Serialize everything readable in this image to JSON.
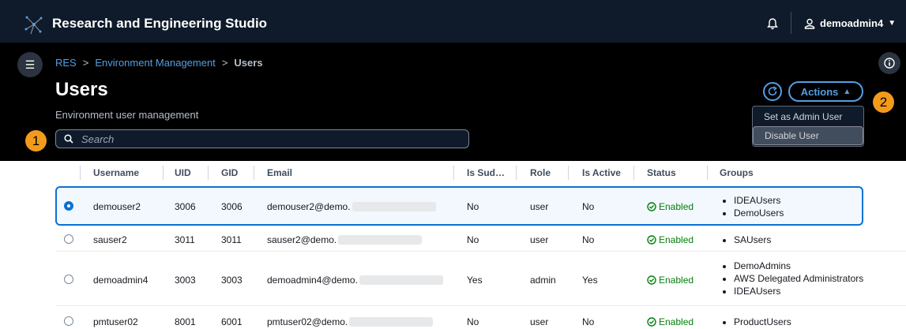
{
  "app": {
    "title": "Research and Engineering Studio",
    "username": "demoadmin4"
  },
  "breadcrumb": [
    "RES",
    "Environment Management",
    "Users"
  ],
  "page": {
    "title": "Users",
    "subtitle": "Environment user management"
  },
  "search": {
    "placeholder": "Search"
  },
  "actions": {
    "label": "Actions",
    "menu": [
      "Set as Admin User",
      "Disable User"
    ]
  },
  "callouts": [
    "1",
    "2"
  ],
  "table": {
    "columns": [
      "Username",
      "UID",
      "GID",
      "Email",
      "Is Sud…",
      "Role",
      "Is Active",
      "Status",
      "Groups"
    ],
    "rows": [
      {
        "selected": true,
        "username": "demouser2",
        "uid": "3006",
        "gid": "3006",
        "email": "demouser2@demo.",
        "sudo": "No",
        "role": "user",
        "active": "No",
        "status": "Enabled",
        "groups": [
          "IDEAUsers",
          "DemoUsers"
        ]
      },
      {
        "selected": false,
        "username": "sauser2",
        "uid": "3011",
        "gid": "3011",
        "email": "sauser2@demo.",
        "sudo": "No",
        "role": "user",
        "active": "No",
        "status": "Enabled",
        "groups": [
          "SAUsers"
        ]
      },
      {
        "selected": false,
        "username": "demoadmin4",
        "uid": "3003",
        "gid": "3003",
        "email": "demoadmin4@demo.",
        "sudo": "Yes",
        "role": "admin",
        "active": "Yes",
        "status": "Enabled",
        "groups": [
          "DemoAdmins",
          "AWS Delegated Administrators",
          "IDEAUsers"
        ]
      },
      {
        "selected": false,
        "username": "pmtuser02",
        "uid": "8001",
        "gid": "6001",
        "email": "pmtuser02@demo.",
        "sudo": "No",
        "role": "user",
        "active": "No",
        "status": "Enabled",
        "groups": [
          "ProductUsers"
        ]
      }
    ]
  },
  "colors": {
    "header_bg": "#0f1b2a",
    "accent": "#539fe5",
    "selected": "#0972d3",
    "enabled": "#037f0c",
    "callout": "#f29b1a"
  }
}
